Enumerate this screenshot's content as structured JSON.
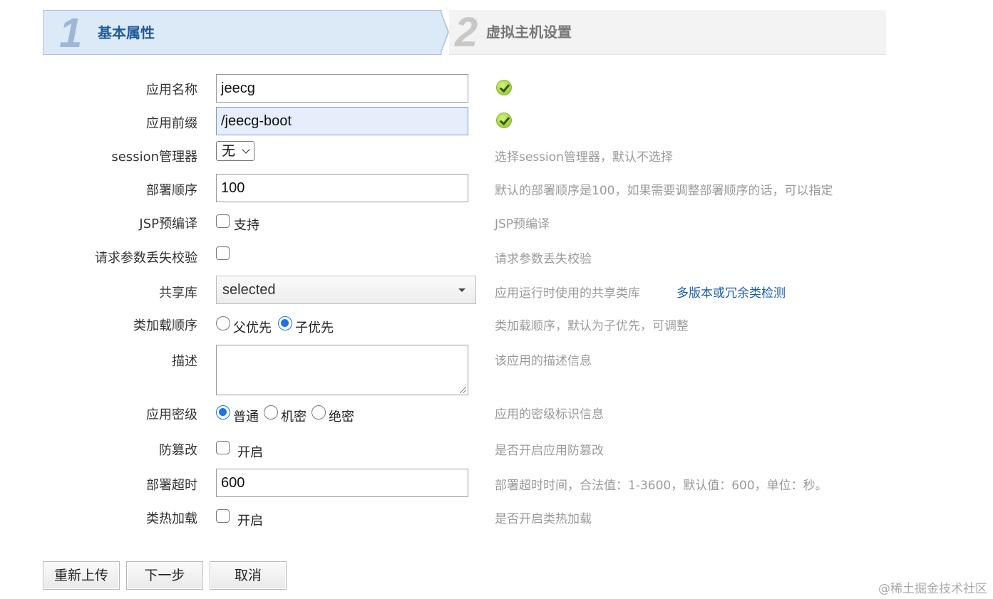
{
  "wizard": {
    "step1": {
      "number": "1",
      "title": "基本属性"
    },
    "step2": {
      "number": "2",
      "title": "虚拟主机设置"
    }
  },
  "form": {
    "app_name": {
      "label": "应用名称",
      "value": "jeecg"
    },
    "app_prefix": {
      "label": "应用前缀",
      "value": "/jeecg-boot"
    },
    "session_manager": {
      "label": "session管理器",
      "selected": "无",
      "hint": "选择session管理器，默认不选择"
    },
    "deploy_order": {
      "label": "部署顺序",
      "value": "100",
      "hint": "默认的部署顺序是100，如果需要调整部署顺序的话，可以指定"
    },
    "jsp_precompile": {
      "label": "JSP预编译",
      "option": "支持",
      "hint": "JSP预编译"
    },
    "param_loss_check": {
      "label": "请求参数丢失校验",
      "hint": "请求参数丢失校验"
    },
    "shared_lib": {
      "label": "共享库",
      "selected": "selected",
      "hint": "应用运行时使用的共享类库",
      "link": "多版本或冗余类检测"
    },
    "class_load_order": {
      "label": "类加载顺序",
      "options": [
        "父优先",
        "子优先"
      ],
      "selected": "子优先",
      "hint": "类加载顺序，默认为子优先，可调整"
    },
    "description": {
      "label": "描述",
      "value": "",
      "hint": "该应用的描述信息"
    },
    "security_level": {
      "label": "应用密级",
      "options": [
        "普通",
        "机密",
        "绝密"
      ],
      "selected": "普通",
      "hint": "应用的密级标识信息"
    },
    "tamper_proof": {
      "label": "防篡改",
      "option": "开启",
      "hint": "是否开启应用防篡改"
    },
    "deploy_timeout": {
      "label": "部署超时",
      "value": "600",
      "hint": "部署超时时间，合法值：1-3600，默认值：600，单位：秒。"
    },
    "hot_reload": {
      "label": "类热加载",
      "option": "开启",
      "hint": "是否开启类热加载"
    }
  },
  "buttons": {
    "reupload": "重新上传",
    "next": "下一步",
    "cancel": "取消"
  },
  "watermark": "@稀土掘金技术社区"
}
